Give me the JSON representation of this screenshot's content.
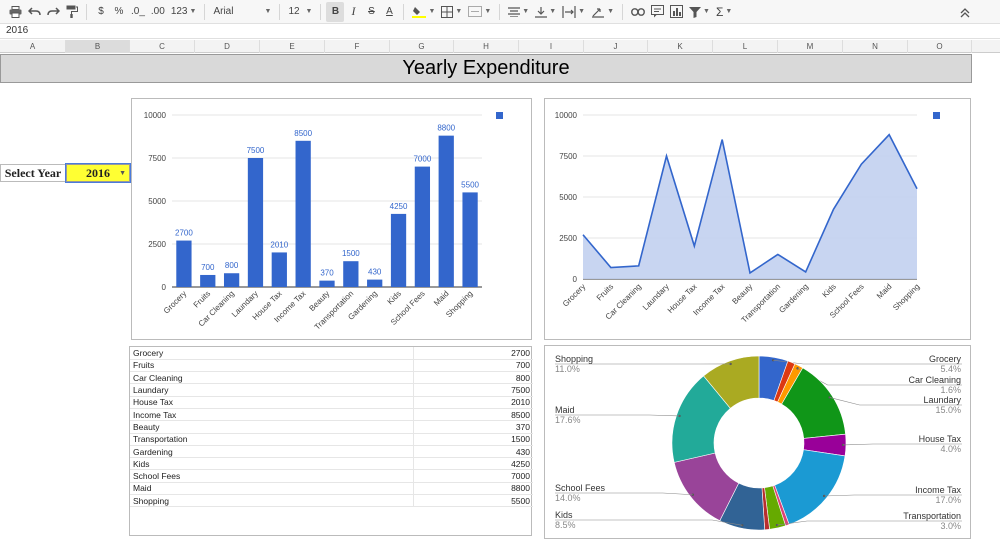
{
  "formula_bar": {
    "value": "2016"
  },
  "toolbar": {
    "currency": "$",
    "percent": "%",
    "decimal_decrease": ".0_",
    "decimal_increase": ".00",
    "number_format": "123",
    "font": "Arial",
    "font_size": "12",
    "bold": "B",
    "italic": "I",
    "strike": "S",
    "text_color": "A",
    "function": "Σ"
  },
  "columns": [
    "A",
    "B",
    "C",
    "D",
    "E",
    "F",
    "G",
    "H",
    "I",
    "J",
    "K",
    "L",
    "M",
    "N",
    "O"
  ],
  "sheet": {
    "title": "Yearly Expenditure",
    "select_year_label": "Select Year",
    "selected_year": "2016"
  },
  "table": {
    "rows": [
      {
        "name": "Grocery",
        "value": "2700"
      },
      {
        "name": "Fruits",
        "value": "700"
      },
      {
        "name": "Car Cleaning",
        "value": "800"
      },
      {
        "name": "Laundary",
        "value": "7500"
      },
      {
        "name": "House Tax",
        "value": "2010"
      },
      {
        "name": "Income Tax",
        "value": "8500"
      },
      {
        "name": "Beauty",
        "value": "370"
      },
      {
        "name": "Transportation",
        "value": "1500"
      },
      {
        "name": "Gardening",
        "value": "430"
      },
      {
        "name": "Kids",
        "value": "4250"
      },
      {
        "name": "School Fees",
        "value": "7000"
      },
      {
        "name": "Maid",
        "value": "8800"
      },
      {
        "name": "Shopping",
        "value": "5500"
      }
    ]
  },
  "chart_data": [
    {
      "type": "bar",
      "categories": [
        "Grocery",
        "Fruits",
        "Car Cleaning",
        "Laundary",
        "House Tax",
        "Income Tax",
        "Beauty",
        "Transportation",
        "Gardening",
        "Kids",
        "School Fees",
        "Maid",
        "Shopping"
      ],
      "values": [
        2700,
        700,
        800,
        7500,
        2010,
        8500,
        370,
        1500,
        430,
        4250,
        7000,
        8800,
        5500
      ],
      "ylim": [
        0,
        10000
      ],
      "yticks": [
        0,
        2500,
        5000,
        7500,
        10000
      ],
      "color": "#3366cc",
      "grid": true,
      "legend": "top-right",
      "data_labels": true
    },
    {
      "type": "area",
      "categories": [
        "Grocery",
        "Fruits",
        "Car Cleaning",
        "Laundary",
        "House Tax",
        "Income Tax",
        "Beauty",
        "Transportation",
        "Gardening",
        "Kids",
        "School Fees",
        "Maid",
        "Shopping"
      ],
      "values": [
        2700,
        700,
        800,
        7500,
        2010,
        8500,
        370,
        1500,
        430,
        4250,
        7000,
        8800,
        5500
      ],
      "ylim": [
        0,
        10000
      ],
      "yticks": [
        0,
        2500,
        5000,
        7500,
        10000
      ],
      "color": "#3366cc",
      "fill_color": "#c2d0ef",
      "grid": true,
      "legend": "top-right"
    },
    {
      "type": "pie",
      "donut": true,
      "slices": [
        {
          "name": "Grocery",
          "percent": "5.4%",
          "value": 5.4,
          "color": "#3366cc",
          "side": "right"
        },
        {
          "name": "",
          "percent": "",
          "value": 1.4,
          "color": "#dc3912",
          "side": "none"
        },
        {
          "name": "Car Cleaning",
          "percent": "1.6%",
          "value": 1.6,
          "color": "#ff9900",
          "side": "right"
        },
        {
          "name": "Laundary",
          "percent": "15.0%",
          "value": 15.0,
          "color": "#109618",
          "side": "right"
        },
        {
          "name": "House Tax",
          "percent": "4.0%",
          "value": 4.0,
          "color": "#990099",
          "side": "right"
        },
        {
          "name": "Income Tax",
          "percent": "17.0%",
          "value": 17.0,
          "color": "#1b9ad3",
          "side": "right"
        },
        {
          "name": "",
          "percent": "",
          "value": 0.7,
          "color": "#dd4477",
          "side": "none"
        },
        {
          "name": "Transportation",
          "percent": "3.0%",
          "value": 3.0,
          "color": "#66aa00",
          "side": "right"
        },
        {
          "name": "",
          "percent": "",
          "value": 0.9,
          "color": "#b82e2e",
          "side": "none"
        },
        {
          "name": "Kids",
          "percent": "8.5%",
          "value": 8.5,
          "color": "#316395",
          "side": "left"
        },
        {
          "name": "School Fees",
          "percent": "14.0%",
          "value": 14.0,
          "color": "#994499",
          "side": "left"
        },
        {
          "name": "Maid",
          "percent": "17.6%",
          "value": 17.6,
          "color": "#22aa99",
          "side": "left"
        },
        {
          "name": "Shopping",
          "percent": "11.0%",
          "value": 11.0,
          "color": "#aaaa22",
          "side": "left"
        }
      ]
    }
  ]
}
